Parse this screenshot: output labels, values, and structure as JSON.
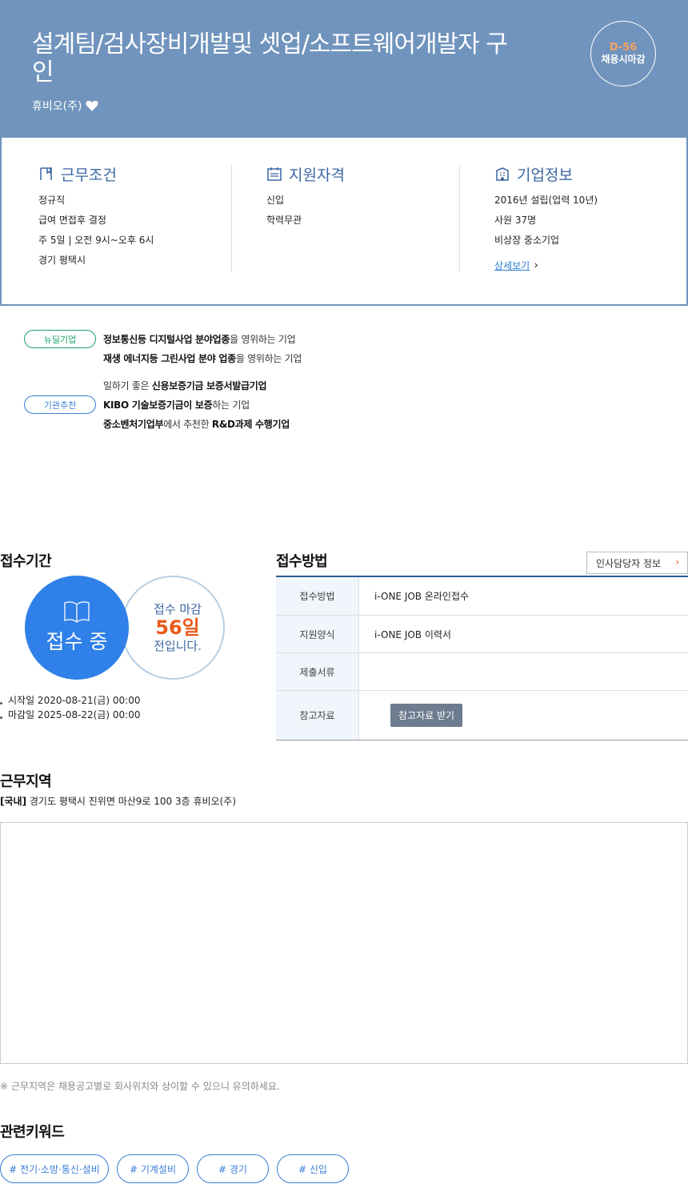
{
  "header": {
    "title": "설계팀/검사장비개발및 셋업/소프트웨어개발자 구인",
    "company": "휴비오(주)",
    "dday_count": "D-56",
    "dday_label": "채용시마감"
  },
  "summary": {
    "work": {
      "title": "근무조건",
      "lines": [
        "정규직",
        "급여 면접후 결정",
        "주 5일 | 오전 9시~오후 6시",
        "경기 평택시"
      ]
    },
    "qualify": {
      "title": "지원자격",
      "lines": [
        "신입",
        "학력무관"
      ]
    },
    "company": {
      "title": "기업정보",
      "lines": [
        "2016년 설립(업력 10년)",
        "사원 37명",
        "비상장 중소기업"
      ],
      "more_label": "상세보기"
    }
  },
  "badges": {
    "green": {
      "label": "뉴딜기업",
      "lines": [
        {
          "bold1": "정보통신등 디지털사업 분야업종",
          "rest": "을 영위하는 기업"
        },
        {
          "bold1": "재생 에너지등 그린사업 분야 업종",
          "rest": "을 영위하는 기업"
        }
      ]
    },
    "blue": {
      "label": "기관추천",
      "line1": {
        "pre": "일하기 좋은 ",
        "bold": "신용보증기금 보증서발급기업"
      },
      "line2": {
        "bold": "KIBO 기술보증기금이 보증",
        "rest": "하는 기업"
      },
      "line3": {
        "bold1": "중소벤처기업부",
        "mid": "에서 추천한 ",
        "bold2": "R&D과제 수행기업"
      }
    }
  },
  "period": {
    "title": "접수기간",
    "status": "접수 중",
    "deadline_line1": "접수 마감",
    "deadline_days": "56일",
    "deadline_line3": "전입니다.",
    "start": "시작일 2020-08-21(금) 00:00",
    "end": "마감일 2025-08-22(금) 00:00"
  },
  "method": {
    "title": "접수방법",
    "hr_button": "인사담당자 정보",
    "rows": [
      {
        "label": "접수방법",
        "value": "i-ONE JOB 온라인접수"
      },
      {
        "label": "지원양식",
        "value": "i-ONE JOB 이력서"
      },
      {
        "label": "제출서류",
        "value": ""
      },
      {
        "label": "참고자료",
        "value": ""
      }
    ],
    "ref_button": "참고자료 받기"
  },
  "location": {
    "title": "근무지역",
    "tag": "[국내]",
    "address": "경기도 평택시 진위면 마산9로 100 3층 휴비오(주)",
    "note": "※ 근무지역은 채용공고별로 회사위치와 상이할 수 있으니 유의하세요."
  },
  "keywords": {
    "title": "관련키워드",
    "items": [
      "# 전기·소방·통신·설비",
      "# 기계설비",
      "# 경기",
      "# 신입"
    ]
  },
  "colors": {
    "header_bg": "#7094bd",
    "accent_blue": "#2f80e8",
    "accent_orange": "#e8591a",
    "green": "#1fa06a"
  }
}
